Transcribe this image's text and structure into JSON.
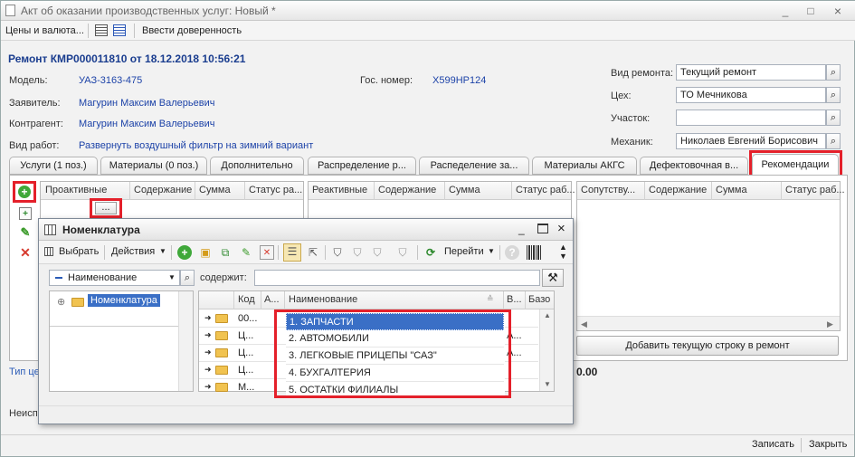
{
  "window": {
    "title": "Акт об оказании производственных услуг: Новый *",
    "controls": [
      "_",
      "□",
      "×"
    ]
  },
  "toolbar": {
    "prices_label": "Цены и валюта...",
    "proxy_label": "Ввести доверенность"
  },
  "header": {
    "doc_title": "Ремонт КМР000011810 от 18.12.2018 10:56:21",
    "model_label": "Модель:",
    "model_value": "УАЗ-3163-475",
    "gosnomer_label": "Гос. номер:",
    "gosnomer_value": "Х599НР124",
    "applicant_label": "Заявитель:",
    "applicant_value": "Магурин Максим Валерьевич",
    "counterparty_label": "Контрагент:",
    "counterparty_value": "Магурин Максим Валерьевич",
    "worktype_label": "Вид работ:",
    "worktype_value": "Развернуть воздушный фильтр на зимний вариант",
    "repair_type_label": "Вид ремонта:",
    "repair_type_value": "Текущий ремонт",
    "shop_label": "Цех:",
    "shop_value": "ТО Мечникова",
    "section_label": "Участок:",
    "section_value": "",
    "mechanic_label": "Механик:",
    "mechanic_value": "Николаев Евгений Борисович"
  },
  "tabs": [
    {
      "label": "Услуги (1 поз.)"
    },
    {
      "label": "Материалы (0 поз.)"
    },
    {
      "label": "Дополнительно"
    },
    {
      "label": "Распределение р..."
    },
    {
      "label": "Распеделение за..."
    },
    {
      "label": "Материалы АКГС"
    },
    {
      "label": "Дефектовочная в..."
    },
    {
      "label": "Рекомендации"
    }
  ],
  "grids": {
    "proactive": {
      "cols": [
        "Проактивные",
        "Содержание",
        "Сумма",
        "Статус ра..."
      ],
      "ellipsis": "..."
    },
    "reactive": {
      "cols": [
        "Реактивные",
        "Содержание",
        "Сумма",
        "Статус раб..."
      ]
    },
    "related": {
      "cols": [
        "Сопутству...",
        "Содержание",
        "Сумма",
        "Статус раб..."
      ]
    }
  },
  "add_row_button": "Добавить текущую строку в ремонт",
  "sum_value": "0.00",
  "bottom_left_1": "Тип це",
  "bottom_left_2": "Неисп",
  "footer": {
    "save": "Записать",
    "close": "Закрыть"
  },
  "dialog": {
    "title": "Номенклатура",
    "select_label": "Выбрать",
    "actions_label": "Действия",
    "goto_label": "Перейти",
    "filter_field": "Наименование",
    "contains_label": "содержит:",
    "tree_root": "Номенклатура",
    "columns": [
      "Код",
      "А...",
      "Наименование",
      "В...",
      "Базо"
    ],
    "rows": [
      {
        "code": "00...",
        "extra": ""
      },
      {
        "code": "Ц...",
        "extra": "А..."
      },
      {
        "code": "Ц...",
        "extra": "А..."
      },
      {
        "code": "Ц...",
        "extra": ""
      },
      {
        "code": "М...",
        "extra": ""
      }
    ],
    "dropdown": [
      "1. ЗАПЧАСТИ",
      "2. АВТОМОБИЛИ",
      "3. ЛЕГКОВЫЕ ПРИЦЕПЫ \"САЗ\"",
      "4. БУХГАЛТЕРИЯ",
      "5. ОСТАТКИ ФИЛИАЛЫ"
    ]
  }
}
